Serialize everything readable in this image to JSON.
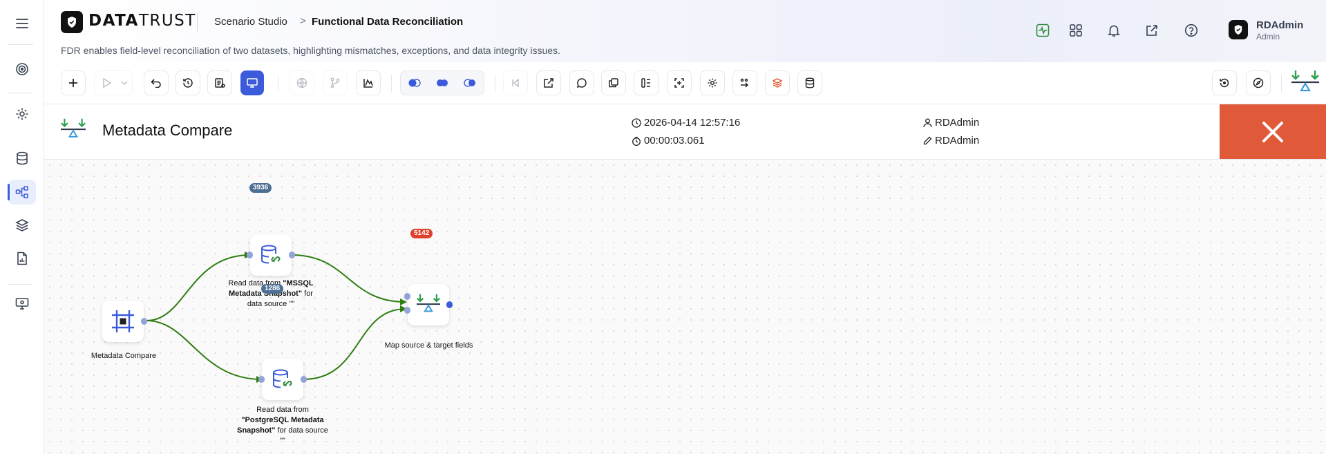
{
  "brand": {
    "name_bold": "DATA",
    "name_light": "TRUST"
  },
  "breadcrumb": {
    "parent": "Scenario Studio",
    "separator": ">",
    "current": "Functional Data Reconciliation"
  },
  "subtitle": "FDR enables field-level reconciliation of two datasets, highlighting mismatches, exceptions, and data integrity issues.",
  "user": {
    "name": "RDAdmin",
    "role": "Admin"
  },
  "sidebar": {
    "items": [
      {
        "icon": "menu-icon"
      },
      {
        "icon": "target-icon"
      },
      {
        "icon": "gear-icon"
      },
      {
        "icon": "database-icon"
      },
      {
        "icon": "workflow-icon",
        "active": true
      },
      {
        "icon": "layers-icon"
      },
      {
        "icon": "report-icon"
      },
      {
        "icon": "monitor-settings-icon"
      }
    ]
  },
  "header_icons": [
    "activity-icon",
    "apps-grid-icon",
    "bell-icon",
    "external-link-icon",
    "help-icon"
  ],
  "info": {
    "title": "Metadata Compare",
    "timestamp": "2026-04-14 12:57:16",
    "duration": "00:00:03.061",
    "created_by": "RDAdmin",
    "edited_by": "RDAdmin"
  },
  "nodes": {
    "start": {
      "label": "Metadata Compare"
    },
    "mssql": {
      "badge": "3936",
      "label_pre": "Read data from ",
      "label_bold": "\"MSSQL Metadata Snapshot\"",
      "label_post": " for data source \"\""
    },
    "postgres": {
      "badge": "1286",
      "label_pre": "Read data from ",
      "label_bold": "\"PostgreSQL Metadata Snapshot\"",
      "label_post": " for data source \"\""
    },
    "map": {
      "badge": "5142",
      "label": "Map source & target fields"
    }
  },
  "colors": {
    "accent": "#3b5bdb",
    "edge": "#2e7d12",
    "close": "#e05a3a",
    "badge_count": "#4d6f94",
    "badge_alert": "#e0402a"
  }
}
